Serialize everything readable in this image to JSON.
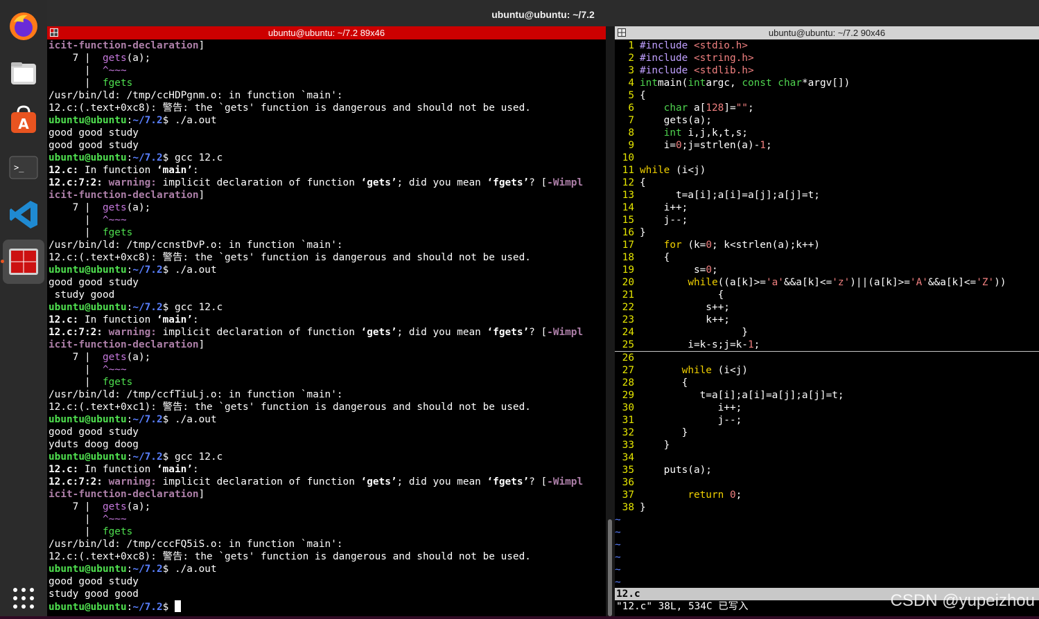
{
  "window": {
    "title": "ubuntu@ubuntu: ~/7.2"
  },
  "dock": {
    "items": [
      {
        "name": "firefox-icon"
      },
      {
        "name": "files-icon"
      },
      {
        "name": "software-center-icon"
      },
      {
        "name": "terminal-icon"
      },
      {
        "name": "vscode-icon"
      },
      {
        "name": "terminator-icon"
      }
    ],
    "apps_grid": "apps-grid-icon",
    "accent": "#e95420"
  },
  "left_pane": {
    "title": "ubuntu@ubuntu: ~/7.2 89x46",
    "header_color": "#cc0000",
    "prompt_user": "ubuntu@ubuntu",
    "prompt_path": "~/7.2",
    "lines": [
      {
        "t": "plain-purple",
        "a": "icit-function-declaration",
        "b": "]"
      },
      {
        "t": "code",
        "a": "    7 |  ",
        "b": "gets",
        "c": "(a);"
      },
      {
        "t": "caret",
        "a": "      |  ",
        "b": "^~~~"
      },
      {
        "t": "fix",
        "a": "      |  ",
        "b": "fgets"
      },
      {
        "t": "plain",
        "a": "/usr/bin/ld: /tmp/ccHDPgnm.o: in function `main':"
      },
      {
        "t": "plain",
        "a": "12.c:(.text+0xc8): 警告: the `gets' function is dangerous and should not be used."
      },
      {
        "t": "prompt",
        "cmd": "./a.out"
      },
      {
        "t": "plain",
        "a": "good good study"
      },
      {
        "t": "plain",
        "a": "good good study"
      },
      {
        "t": "prompt",
        "cmd": "gcc 12.c"
      },
      {
        "t": "infunc",
        "a": "12.c:",
        "b": " In function ",
        "c": "‘main’",
        "d": ":"
      },
      {
        "t": "warn",
        "a": "12.c:7:2:",
        "b": " warning:",
        "c": " implicit declaration of function ",
        "d": "‘gets’",
        "e": "; did you mean ",
        "f": "‘fgets’",
        "g": "? [",
        "h": "-Wimpl"
      },
      {
        "t": "plain-purple",
        "a": "icit-function-declaration",
        "b": "]"
      },
      {
        "t": "code",
        "a": "    7 |  ",
        "b": "gets",
        "c": "(a);"
      },
      {
        "t": "caret",
        "a": "      |  ",
        "b": "^~~~"
      },
      {
        "t": "fix",
        "a": "      |  ",
        "b": "fgets"
      },
      {
        "t": "plain",
        "a": "/usr/bin/ld: /tmp/ccnstDvP.o: in function `main':"
      },
      {
        "t": "plain",
        "a": "12.c:(.text+0xc8): 警告: the `gets' function is dangerous and should not be used."
      },
      {
        "t": "prompt",
        "cmd": "./a.out"
      },
      {
        "t": "plain",
        "a": "good good study"
      },
      {
        "t": "plain",
        "a": " study good"
      },
      {
        "t": "prompt",
        "cmd": "gcc 12.c"
      },
      {
        "t": "infunc",
        "a": "12.c:",
        "b": " In function ",
        "c": "‘main’",
        "d": ":"
      },
      {
        "t": "warn",
        "a": "12.c:7:2:",
        "b": " warning:",
        "c": " implicit declaration of function ",
        "d": "‘gets’",
        "e": "; did you mean ",
        "f": "‘fgets’",
        "g": "? [",
        "h": "-Wimpl"
      },
      {
        "t": "plain-purple",
        "a": "icit-function-declaration",
        "b": "]"
      },
      {
        "t": "code",
        "a": "    7 |  ",
        "b": "gets",
        "c": "(a);"
      },
      {
        "t": "caret",
        "a": "      |  ",
        "b": "^~~~"
      },
      {
        "t": "fix",
        "a": "      |  ",
        "b": "fgets"
      },
      {
        "t": "plain",
        "a": "/usr/bin/ld: /tmp/ccfTiuLj.o: in function `main':"
      },
      {
        "t": "plain",
        "a": "12.c:(.text+0xc1): 警告: the `gets' function is dangerous and should not be used."
      },
      {
        "t": "prompt",
        "cmd": "./a.out"
      },
      {
        "t": "plain",
        "a": "good good study"
      },
      {
        "t": "plain",
        "a": "yduts doog doog"
      },
      {
        "t": "prompt",
        "cmd": "gcc 12.c"
      },
      {
        "t": "infunc",
        "a": "12.c:",
        "b": " In function ",
        "c": "‘main’",
        "d": ":"
      },
      {
        "t": "warn",
        "a": "12.c:7:2:",
        "b": " warning:",
        "c": " implicit declaration of function ",
        "d": "‘gets’",
        "e": "; did you mean ",
        "f": "‘fgets’",
        "g": "? [",
        "h": "-Wimpl"
      },
      {
        "t": "plain-purple",
        "a": "icit-function-declaration",
        "b": "]"
      },
      {
        "t": "code",
        "a": "    7 |  ",
        "b": "gets",
        "c": "(a);"
      },
      {
        "t": "caret",
        "a": "      |  ",
        "b": "^~~~"
      },
      {
        "t": "fix",
        "a": "      |  ",
        "b": "fgets"
      },
      {
        "t": "plain",
        "a": "/usr/bin/ld: /tmp/cccFQ5iS.o: in function `main':"
      },
      {
        "t": "plain",
        "a": "12.c:(.text+0xc8): 警告: the `gets' function is dangerous and should not be used."
      },
      {
        "t": "prompt",
        "cmd": "./a.out"
      },
      {
        "t": "plain",
        "a": "good good study"
      },
      {
        "t": "plain",
        "a": "study good good"
      },
      {
        "t": "prompt",
        "cmd": "",
        "cursor": true
      }
    ]
  },
  "right_pane": {
    "title": "ubuntu@ubuntu: ~/7.2 90x46",
    "code_top": [
      {
        "n": "1",
        "s": [
          [
            "pp",
            "#include "
          ],
          [
            "inc",
            "<stdio.h>"
          ]
        ]
      },
      {
        "n": "2",
        "s": [
          [
            "pp",
            "#include "
          ],
          [
            "inc",
            "<string.h>"
          ]
        ]
      },
      {
        "n": "3",
        "s": [
          [
            "pp",
            "#include "
          ],
          [
            "inc",
            "<stdlib.h>"
          ]
        ]
      },
      {
        "n": "4",
        "s": [
          [
            "kw-green",
            "int"
          ],
          [
            "",
            "main("
          ],
          [
            "kw-green",
            "int"
          ],
          [
            "",
            "argc, "
          ],
          [
            "kw-green",
            "const char"
          ],
          [
            "",
            "*argv[])"
          ]
        ]
      },
      {
        "n": "5",
        "s": [
          [
            "",
            "{"
          ]
        ]
      },
      {
        "n": "6",
        "s": [
          [
            "",
            "    "
          ],
          [
            "kw-green",
            "char"
          ],
          [
            "",
            " a["
          ],
          [
            "num",
            "128"
          ],
          [
            "",
            "]="
          ],
          [
            "str",
            "\"\""
          ],
          [
            "",
            ";"
          ]
        ]
      },
      {
        "n": "7",
        "s": [
          [
            "",
            "    gets(a);"
          ]
        ]
      },
      {
        "n": "8",
        "s": [
          [
            "",
            "    "
          ],
          [
            "kw-green",
            "int"
          ],
          [
            "",
            " i,j,k,t,s;"
          ]
        ]
      },
      {
        "n": "9",
        "s": [
          [
            "",
            "    i="
          ],
          [
            "num",
            "0"
          ],
          [
            "",
            ";j=strlen(a)-"
          ],
          [
            "num",
            "1"
          ],
          [
            "",
            ";"
          ]
        ]
      },
      {
        "n": "10",
        "s": []
      },
      {
        "n": "11",
        "s": [
          [
            "kw-yellow",
            "while"
          ],
          [
            "",
            " (i<j)"
          ]
        ]
      },
      {
        "n": "12",
        "s": [
          [
            "",
            "{"
          ]
        ]
      },
      {
        "n": "13",
        "s": [
          [
            "",
            "      t=a[i];a[i]=a[j];a[j]=t;"
          ]
        ]
      },
      {
        "n": "14",
        "s": [
          [
            "",
            "    i++;"
          ]
        ]
      },
      {
        "n": "15",
        "s": [
          [
            "",
            "    j--;"
          ]
        ]
      },
      {
        "n": "16",
        "s": [
          [
            "",
            "}"
          ]
        ]
      },
      {
        "n": "17",
        "s": [
          [
            "",
            "    "
          ],
          [
            "kw-yellow",
            "for"
          ],
          [
            "",
            " (k="
          ],
          [
            "num",
            "0"
          ],
          [
            "",
            "; k<strlen(a);k++)"
          ]
        ]
      },
      {
        "n": "18",
        "s": [
          [
            "",
            "    {"
          ]
        ]
      },
      {
        "n": "19",
        "s": [
          [
            "",
            "         s="
          ],
          [
            "num",
            "0"
          ],
          [
            "",
            ";"
          ]
        ]
      },
      {
        "n": "20",
        "s": [
          [
            "",
            "        "
          ],
          [
            "kw-yellow",
            "while"
          ],
          [
            "",
            "((a[k]>="
          ],
          [
            "str",
            "'a'"
          ],
          [
            "",
            "&&a[k]<="
          ],
          [
            "str",
            "'z'"
          ],
          [
            "",
            ")||(a[k]>="
          ],
          [
            "str",
            "'A'"
          ],
          [
            "",
            "&&a[k]<="
          ],
          [
            "str",
            "'Z'"
          ],
          [
            "",
            "))"
          ]
        ]
      },
      {
        "n": "21",
        "s": [
          [
            "",
            "             {"
          ]
        ]
      },
      {
        "n": "22",
        "s": [
          [
            "",
            "           s++;"
          ]
        ]
      },
      {
        "n": "23",
        "s": [
          [
            "",
            "           k++;"
          ]
        ]
      },
      {
        "n": "24",
        "s": [
          [
            "",
            "                 }"
          ]
        ]
      },
      {
        "n": "25",
        "s": [
          [
            "",
            "        i=k-s;j=k-"
          ],
          [
            "num",
            "1"
          ],
          [
            "",
            ";"
          ]
        ]
      }
    ],
    "code_bottom": [
      {
        "n": "26",
        "s": []
      },
      {
        "n": "27",
        "s": [
          [
            "",
            "       "
          ],
          [
            "kw-yellow",
            "while"
          ],
          [
            "",
            " (i<j)"
          ]
        ]
      },
      {
        "n": "28",
        "s": [
          [
            "",
            "       {"
          ]
        ]
      },
      {
        "n": "29",
        "s": [
          [
            "",
            "          t=a[i];a[i]=a[j];a[j]=t;"
          ]
        ]
      },
      {
        "n": "30",
        "s": [
          [
            "",
            "             i++;"
          ]
        ]
      },
      {
        "n": "31",
        "s": [
          [
            "",
            "             j--;"
          ]
        ]
      },
      {
        "n": "32",
        "s": [
          [
            "",
            "       }"
          ]
        ]
      },
      {
        "n": "33",
        "s": [
          [
            "",
            "    }"
          ]
        ]
      },
      {
        "n": "34",
        "s": []
      },
      {
        "n": "35",
        "s": [
          [
            "",
            "    puts(a);"
          ]
        ]
      },
      {
        "n": "36",
        "s": []
      },
      {
        "n": "37",
        "s": [
          [
            "",
            "        "
          ],
          [
            "kw-yellow",
            "return"
          ],
          [
            "",
            " "
          ],
          [
            "num",
            "0"
          ],
          [
            "",
            ";"
          ]
        ]
      },
      {
        "n": "38",
        "s": [
          [
            "",
            "}"
          ]
        ]
      }
    ],
    "tilde_count": 6,
    "status_file": "12.c",
    "message": "\"12.c\" 38L, 534C 已写入"
  },
  "watermark": "CSDN @yupeizhou"
}
